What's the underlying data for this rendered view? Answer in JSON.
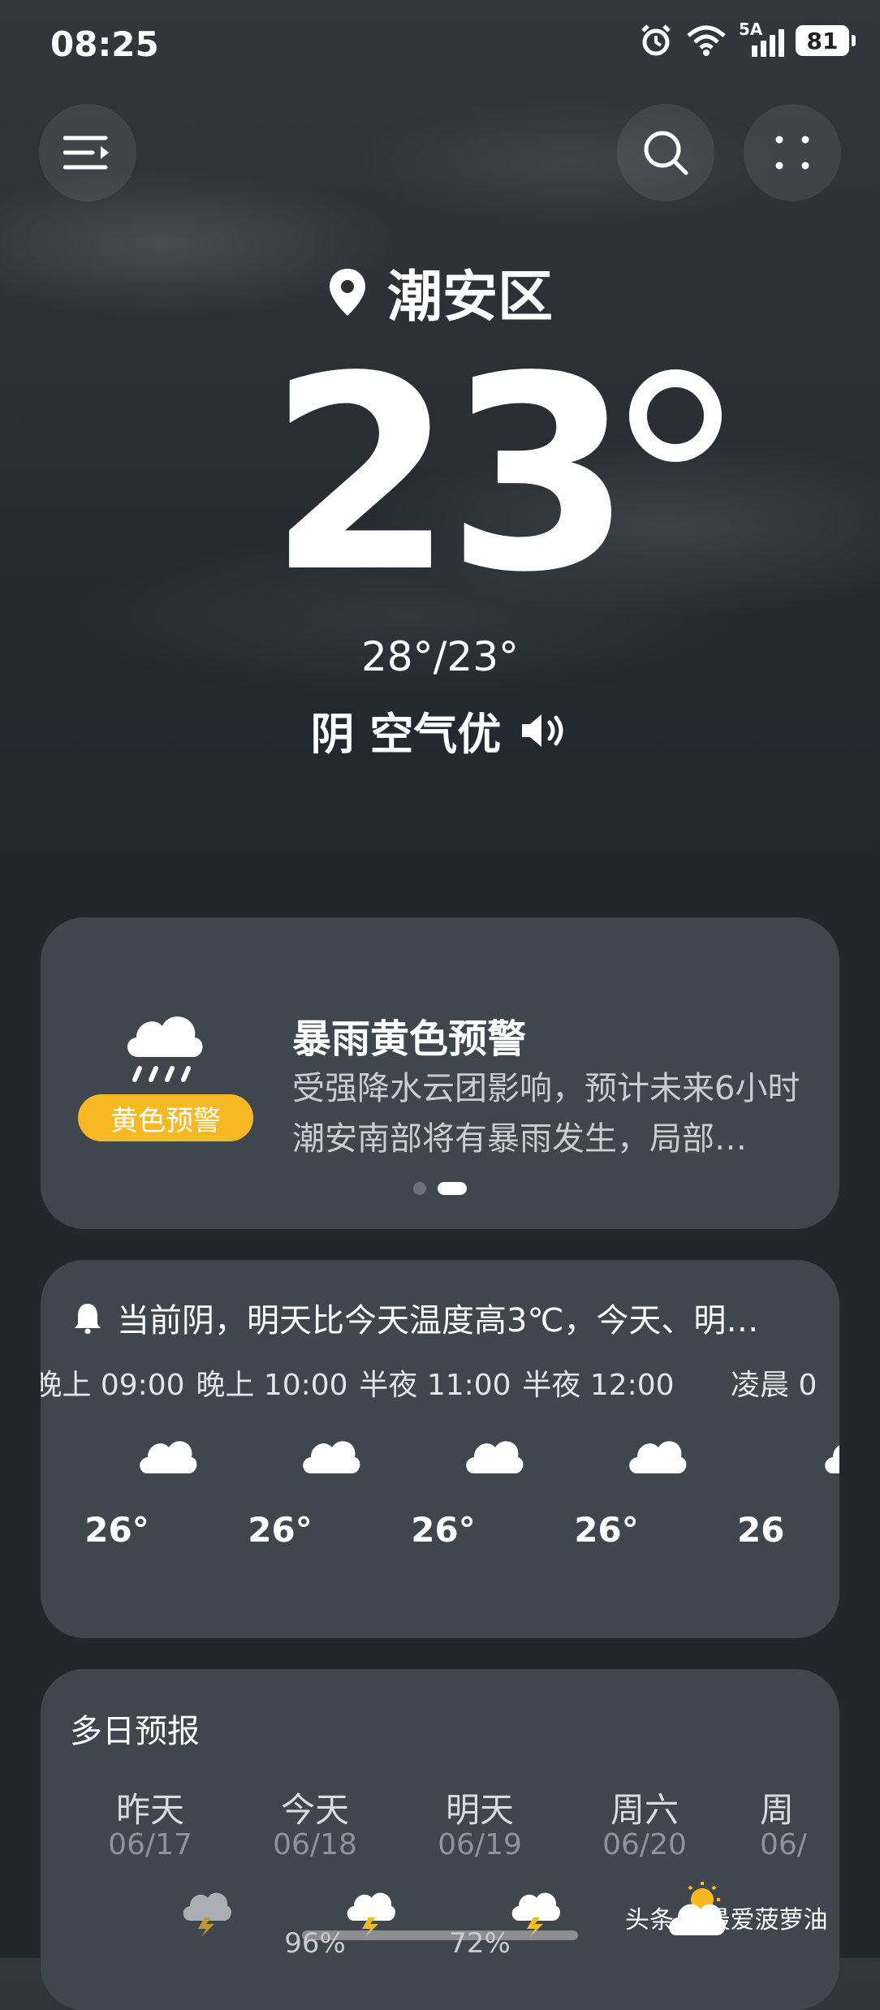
{
  "status_bar": {
    "time": "08:25",
    "network_label": "5A",
    "battery": "81"
  },
  "location": {
    "name": "潮安区"
  },
  "current": {
    "temperature": "23",
    "high_low": "28°/23°",
    "condition": "阴 空气优"
  },
  "alert": {
    "title": "暴雨黄色预警",
    "body": "受强降水云团影响，预计未来6小时潮安南部将有暴雨发生，局部…",
    "badge": "黄色预警",
    "badge_color": "#f7b923"
  },
  "hourly": {
    "summary": "当前阴，明天比今天温度高3℃，今天、明…",
    "items": [
      {
        "time": "晚上 09:00",
        "temp": "26°",
        "icon": "cloud-icon"
      },
      {
        "time": "晚上 10:00",
        "temp": "26°",
        "icon": "cloud-icon"
      },
      {
        "time": "半夜 11:00",
        "temp": "26°",
        "icon": "cloud-icon"
      },
      {
        "time": "半夜 12:00",
        "temp": "26°",
        "icon": "cloud-icon"
      },
      {
        "time": "凌晨 0",
        "temp": "26",
        "icon": "cloud-icon"
      }
    ]
  },
  "daily": {
    "title": "多日预报",
    "items": [
      {
        "name": "昨天",
        "date": "06/17",
        "pct": "",
        "icon": "thunderstorm-icon"
      },
      {
        "name": "今天",
        "date": "06/18",
        "pct": "96%",
        "icon": "thunderstorm-icon"
      },
      {
        "name": "明天",
        "date": "06/19",
        "pct": "72%",
        "icon": "thunderstorm-icon"
      },
      {
        "name": "周六",
        "date": "06/20",
        "pct": "",
        "icon": "partly-sunny-icon"
      },
      {
        "name": "周",
        "date": "06/",
        "pct": "",
        "icon": "cloud-icon"
      }
    ]
  },
  "watermark": {
    "text": "头条 @最爱菠萝油"
  },
  "colors": {
    "card": "#40464e",
    "background": "#22272e"
  }
}
